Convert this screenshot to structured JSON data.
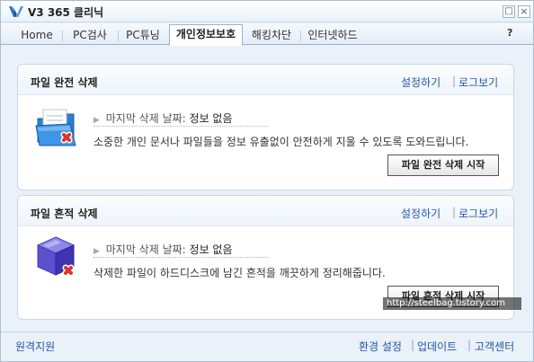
{
  "window": {
    "title": "V3 365 클리닉",
    "minimize_glyph": "□",
    "close_glyph": "×"
  },
  "tabs": [
    {
      "label": "Home"
    },
    {
      "label": "PC검사"
    },
    {
      "label": "PC튜닝"
    },
    {
      "label": "개인정보보호",
      "active": true
    },
    {
      "label": "해킹차단"
    },
    {
      "label": "인터넷하드"
    }
  ],
  "help": {
    "label": "?"
  },
  "panels": [
    {
      "title": "파일 완전 삭제",
      "settings_link": "설정하기",
      "log_link": "로그보기",
      "link_separator": "|",
      "last_label": "마지막 삭제 날짜:",
      "last_value": "정보 없음",
      "description": "소중한 개인 문서나 파일들을 정보 유출없이 안전하게 지울 수 있도록 도와드립니다.",
      "button": "파일 완전 삭제 시작",
      "icon": "folder-delete-icon"
    },
    {
      "title": "파일 흔적 삭제",
      "settings_link": "설정하기",
      "log_link": "로그보기",
      "link_separator": "|",
      "last_label": "마지막 삭제 날짜:",
      "last_value": "정보 없음",
      "description": "삭제한 파일이 하드디스크에 남긴 흔적을 깨끗하게 정리해줍니다.",
      "button": "파일 흔적 삭제 시작",
      "icon": "cube-delete-icon"
    }
  ],
  "footer": {
    "remote": "원격지원",
    "env": "환경 설정",
    "update": "업데이트",
    "support": "고객센터",
    "separator": "|"
  },
  "watermark": "http://steelbag.tistory.com",
  "colors": {
    "link": "#2358a8",
    "frame": "#eaf1f8",
    "delete_x": "#e0322a"
  }
}
